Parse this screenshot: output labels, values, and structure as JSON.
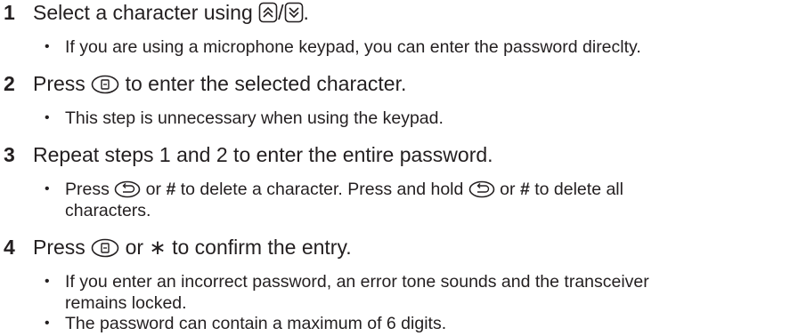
{
  "colors": {
    "text": "#231f20"
  },
  "steps": [
    {
      "num": "1",
      "pre": "Select a character using ",
      "icons": [
        "up-key-icon",
        "down-key-icon"
      ],
      "sep": "/",
      "post": ".",
      "bullets": [
        {
          "text": "If you are using a microphone keypad, you can enter the password direclty."
        }
      ]
    },
    {
      "num": "2",
      "pre": "Press ",
      "icons": [
        "enter-key-icon"
      ],
      "post": " to enter the selected character.",
      "bullets": [
        {
          "text": "This step is unnecessary when using the keypad."
        }
      ]
    },
    {
      "num": "3",
      "text": "Repeat steps 1 and 2 to enter the entire password.",
      "bullets": [
        {
          "a": "Press ",
          "icon1": "back-key-icon",
          "b": " or ",
          "sym1": "#",
          "c": " to delete a character.  Press and hold ",
          "icon2": "back-key-icon",
          "d": " or ",
          "sym2": "#",
          "e": " to delete all",
          "line2": "characters."
        }
      ]
    },
    {
      "num": "4",
      "pre": "Press ",
      "icons": [
        "enter-key-icon"
      ],
      "mid": " or ",
      "sym": "∗",
      "post": " to confirm the entry.",
      "bullets": [
        {
          "line1": "If you enter an incorrect password, an error tone sounds and the transceiver",
          "line2": "remains locked."
        },
        {
          "text": "The password can contain a maximum of 6 digits."
        }
      ]
    }
  ]
}
